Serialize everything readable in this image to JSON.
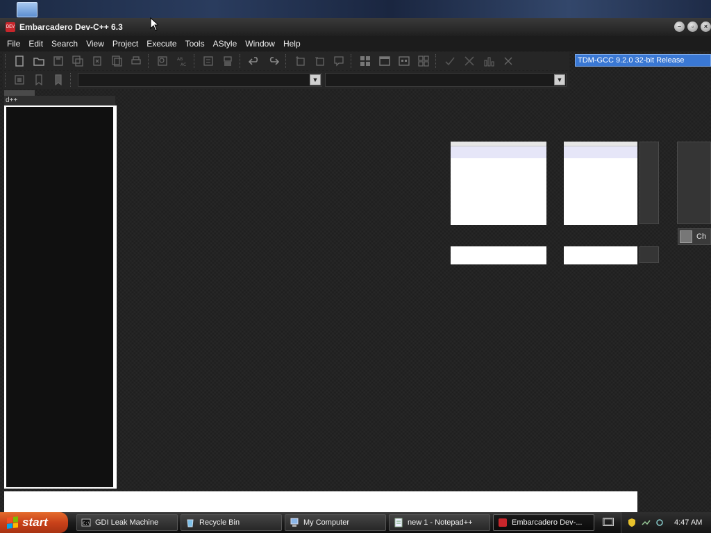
{
  "window": {
    "title": "Embarcadero Dev-C++ 6.3",
    "app_icon_text": "DEV"
  },
  "menu": [
    "File",
    "Edit",
    "Search",
    "View",
    "Project",
    "Execute",
    "Tools",
    "AStyle",
    "Window",
    "Help"
  ],
  "toolbar": {
    "compiler": "TDM-GCC 9.2.0 32-bit Release"
  },
  "left_panel": {
    "label": "d++"
  },
  "right_panel": {
    "ch_button": "Ch"
  },
  "taskbar": {
    "start": "start",
    "items": [
      "GDI Leak Machine",
      "Recycle Bin",
      "My Computer",
      "new 1 - Notepad++",
      "Embarcadero Dev-..."
    ],
    "clock": "4:47 AM"
  },
  "colors": {
    "accent": "#3a78d4",
    "start": "#c9421a"
  }
}
